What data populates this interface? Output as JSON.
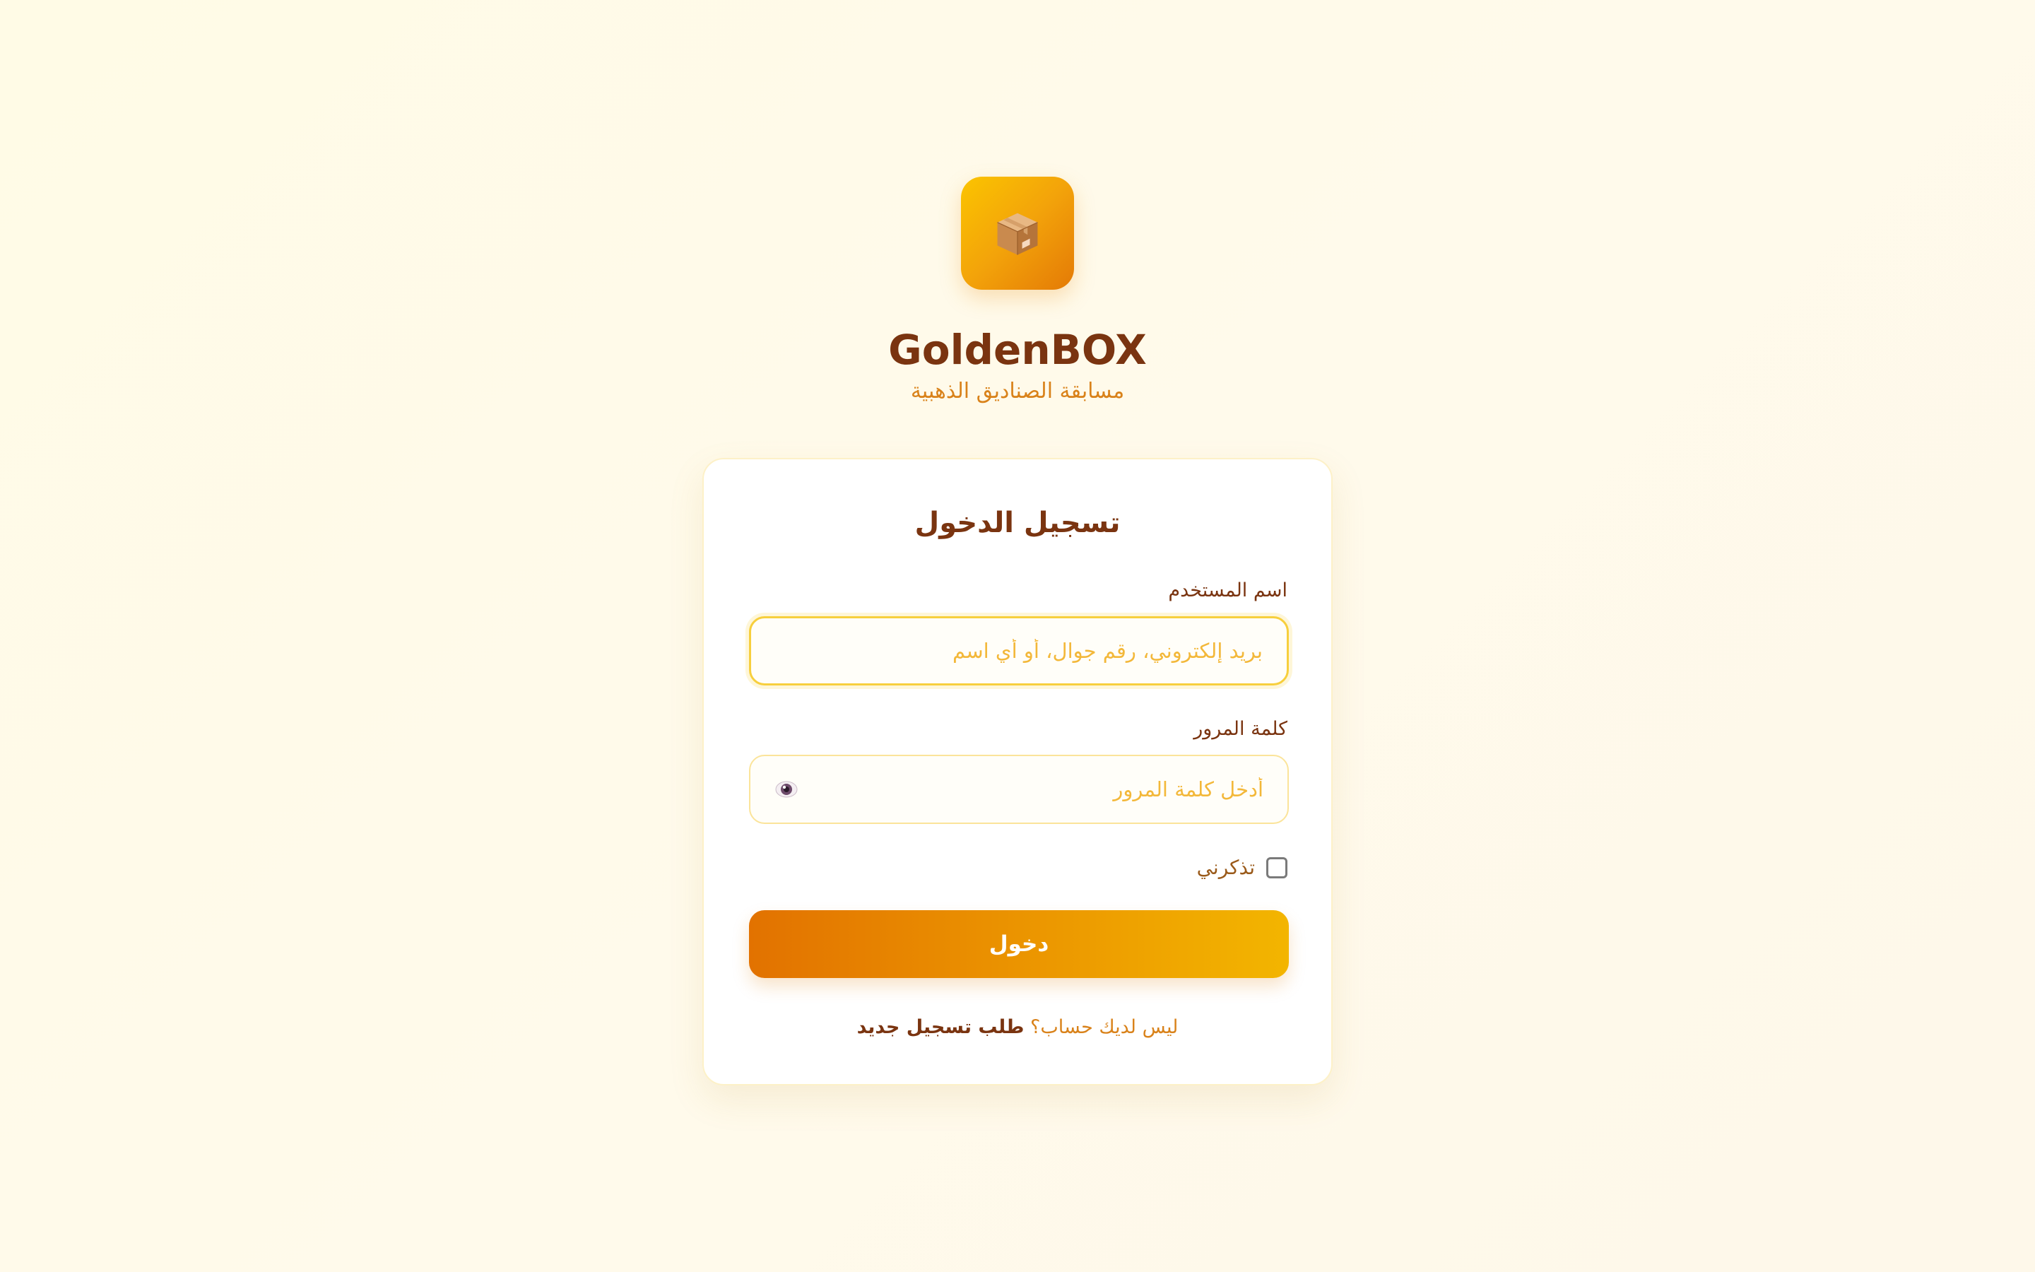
{
  "brand": {
    "logo_icon": "package-box-icon",
    "title": "GoldenBOX",
    "subtitle": "مسابقة الصناديق الذهبية"
  },
  "login": {
    "title": "تسجيل الدخول",
    "username": {
      "label": "اسم المستخدم",
      "value": "",
      "placeholder": "بريد إلكتروني، رقم جوال، أو أي اسم"
    },
    "password": {
      "label": "كلمة المرور",
      "value": "",
      "placeholder": "أدخل كلمة المرور",
      "toggle_icon": "eye-icon"
    },
    "remember": {
      "label": "تذكرني",
      "checked": false
    },
    "submit_label": "دخول",
    "footer": {
      "prompt": "ليس لديك حساب؟",
      "link": "طلب تسجيل جديد"
    }
  },
  "colors": {
    "brand_dark": "#7a3410",
    "accent": "#d9821a",
    "gold_start": "#fbc400",
    "gold_end": "#e47a06",
    "background": "#fffbe6"
  }
}
